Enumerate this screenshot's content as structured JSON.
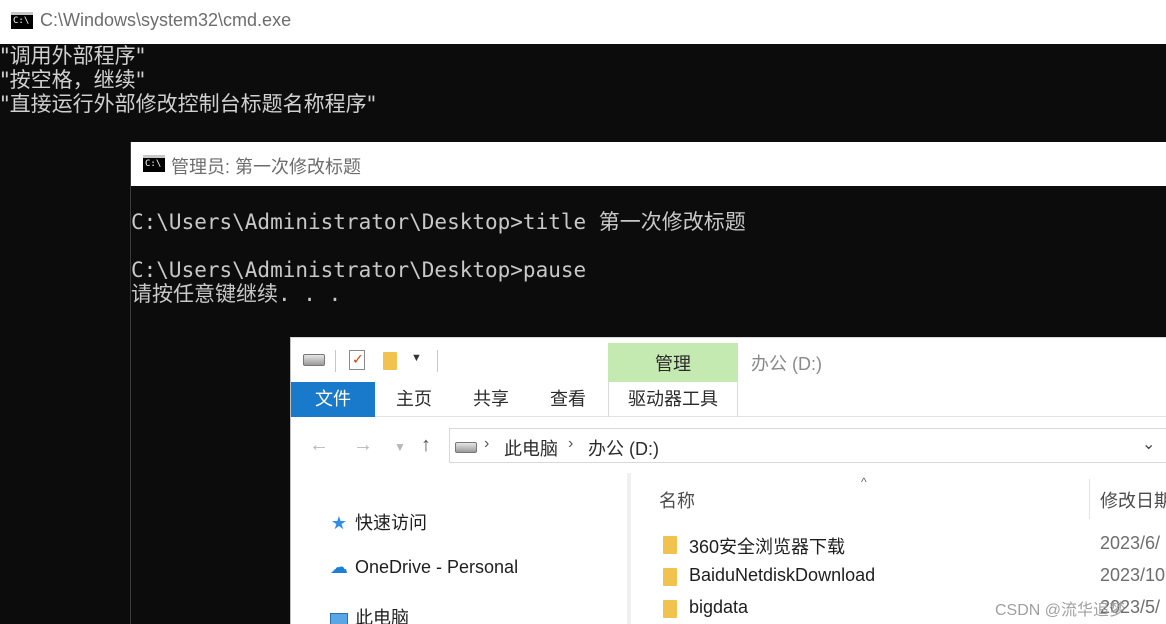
{
  "cmd_window": {
    "icon": "C:\\",
    "title": "C:\\Windows\\system32\\cmd.exe",
    "lines": [
      "\"调用外部程序\"",
      "\"按空格，继续\"",
      "\"直接运行外部修改控制台标题名称程序\""
    ]
  },
  "admin_window": {
    "icon": "C:\\",
    "title": "管理员:  第一次修改标题",
    "lines": [
      "",
      "C:\\Users\\Administrator\\Desktop>title 第一次修改标题",
      "",
      "C:\\Users\\Administrator\\Desktop>pause",
      "请按任意键继续. . ."
    ]
  },
  "explorer": {
    "title": "办公 (D:)",
    "manage_tab": "管理",
    "ribbon_tabs": {
      "file": "文件",
      "home": "主页",
      "share": "共享",
      "view": "查看",
      "drive_tools": "驱动器工具"
    },
    "nav_icons": {
      "back": "arrow-left-icon",
      "forward": "arrow-right-icon",
      "recent": "chevron-down-icon",
      "up": "arrow-up-icon"
    },
    "breadcrumb": [
      "此电脑",
      "办公 (D:)"
    ],
    "nav_pane": [
      {
        "label": "快速访问",
        "icon": "star-icon"
      },
      {
        "label": "OneDrive - Personal",
        "icon": "cloud-icon"
      },
      {
        "label": "此电脑",
        "icon": "computer-icon"
      }
    ],
    "columns": {
      "name": "名称",
      "modified": "修改日期"
    },
    "files": [
      {
        "name": "360安全浏览器下载",
        "modified": "2023/6/"
      },
      {
        "name": "BaiduNetdiskDownload",
        "modified": "2023/10"
      },
      {
        "name": "bigdata",
        "modified": "2023/5/"
      }
    ]
  },
  "watermark": "CSDN @流华追梦"
}
